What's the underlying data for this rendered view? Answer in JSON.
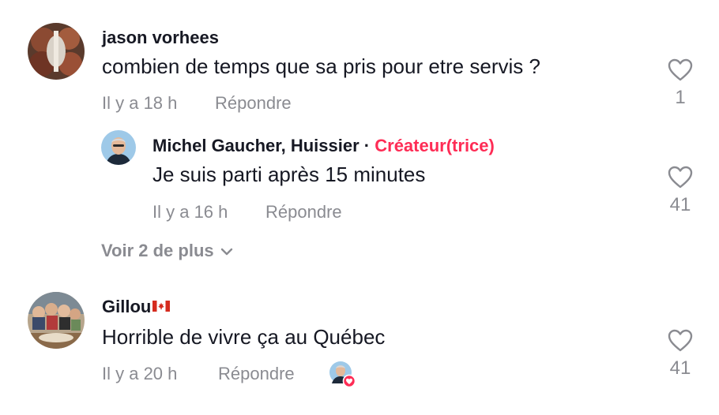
{
  "comments": [
    {
      "username": "jason vorhees",
      "text": "combien de temps que sa pris pour etre servis ?",
      "time": "Il y a 18 h",
      "reply_label": "Répondre",
      "likes": "1"
    },
    {
      "username": "Gillou",
      "username_flag": "canada-flag",
      "text": "Horrible de vivre ça au Québec",
      "time": "Il y a 20 h",
      "reply_label": "Répondre",
      "likes": "41",
      "creator_liked": true
    }
  ],
  "reply": {
    "username": "Michel Gaucher, Huissier",
    "separator": "·",
    "creator_label": "Créateur(trice)",
    "text": "Je suis parti après 15 minutes",
    "time": "Il y a 16 h",
    "reply_label": "Répondre",
    "likes": "41"
  },
  "view_more_label": "Voir 2 de plus",
  "icons": {
    "like": "heart-outline-icon",
    "expand": "chevron-down-icon",
    "creator_like_badge": "heart-badge-icon"
  },
  "colors": {
    "primary_text": "#161823",
    "secondary_text": "#8a8b91",
    "creator_accent": "#fe2c55"
  }
}
